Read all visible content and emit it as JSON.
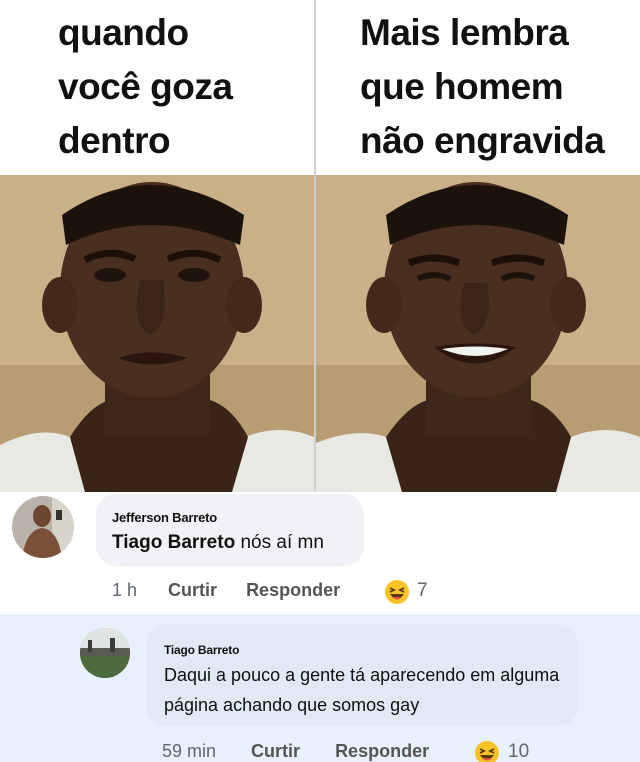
{
  "meme": {
    "caption_left": [
      "quando",
      "você goza",
      "dentro"
    ],
    "caption_right": [
      "Mais lembra",
      "que homem",
      "não engravida"
    ]
  },
  "comments": [
    {
      "author": "Jefferson Barreto",
      "mention": "Tiago Barreto",
      "text": " nós aí mn",
      "time": "1 h",
      "like_label": "Curtir",
      "reply_label": "Responder",
      "reaction_icon": "laughing-emoji-icon",
      "reaction_count": "7"
    },
    {
      "author": "Tiago Barreto",
      "text": "Daqui a pouco a gente tá aparecendo em alguma página achando que somos gay",
      "time": "59 min",
      "like_label": "Curtir",
      "reply_label": "Responder",
      "reaction_icon": "laughing-emoji-icon",
      "reaction_count": "10"
    }
  ],
  "colors": {
    "comment_bubble": "#f0f2f5",
    "reply_background": "#e7f0fb",
    "meta_text": "#606770"
  }
}
